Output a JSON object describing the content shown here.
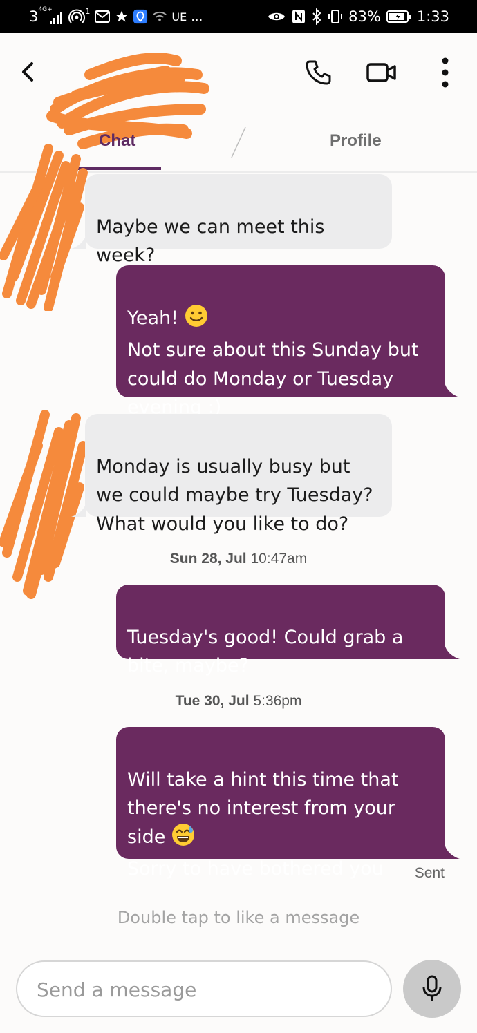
{
  "status_bar": {
    "signal_text": "3",
    "network_badge": "4G+",
    "sim_label": "1",
    "ue_text": "UE",
    "more_text": "...",
    "battery_percent": "83%",
    "time": "1:33",
    "icons": [
      "signal-icon",
      "hotspot-icon",
      "mail-icon",
      "star-icon",
      "vpn-icon",
      "wifi-icon",
      "eye-icon",
      "nfc-icon",
      "bluetooth-icon",
      "vibrate-icon",
      "battery-icon"
    ]
  },
  "header": {
    "call_icon": "phone-icon",
    "video_icon": "video-camera-icon",
    "menu_icon": "more-vertical-icon"
  },
  "tabs": [
    {
      "label": "Chat",
      "active": true
    },
    {
      "label": "Profile",
      "active": false
    }
  ],
  "messages": [
    {
      "side": "in",
      "text": "Maybe we can meet this\nweek?"
    },
    {
      "side": "out",
      "text_before": "Yeah! ",
      "emoji_name": "slight-smile-icon",
      "text_after": "\nNot sure about this Sunday but\ncould do Monday or Tuesday\nevening :)"
    },
    {
      "side": "in",
      "text": "Monday is usually busy but\nwe could maybe try Tuesday?\nWhat would you like to do?"
    },
    {
      "side": "out",
      "text": "Tuesday's good! Could grab a\nbite, maybe?"
    },
    {
      "side": "out",
      "text_before": "Will take a hint this time that\nthere's no interest from your\nside ",
      "emoji_name": "sweat-smile-icon",
      "text_after": "\nSorry to have bothered you"
    }
  ],
  "timestamps": [
    {
      "date": "Sun 28, Jul",
      "time": "10:47am"
    },
    {
      "date": "Tue 30, Jul",
      "time": "5:36pm"
    }
  ],
  "delivery_status": "Sent",
  "hint": "Double tap to like a message",
  "composer": {
    "placeholder": "Send a message",
    "mic_icon": "microphone-icon"
  },
  "colors": {
    "accent": "#5e2b63",
    "outgoing_bubble": "#6a2a5f",
    "incoming_bubble": "#ececed",
    "redaction": "#f58a3c"
  }
}
